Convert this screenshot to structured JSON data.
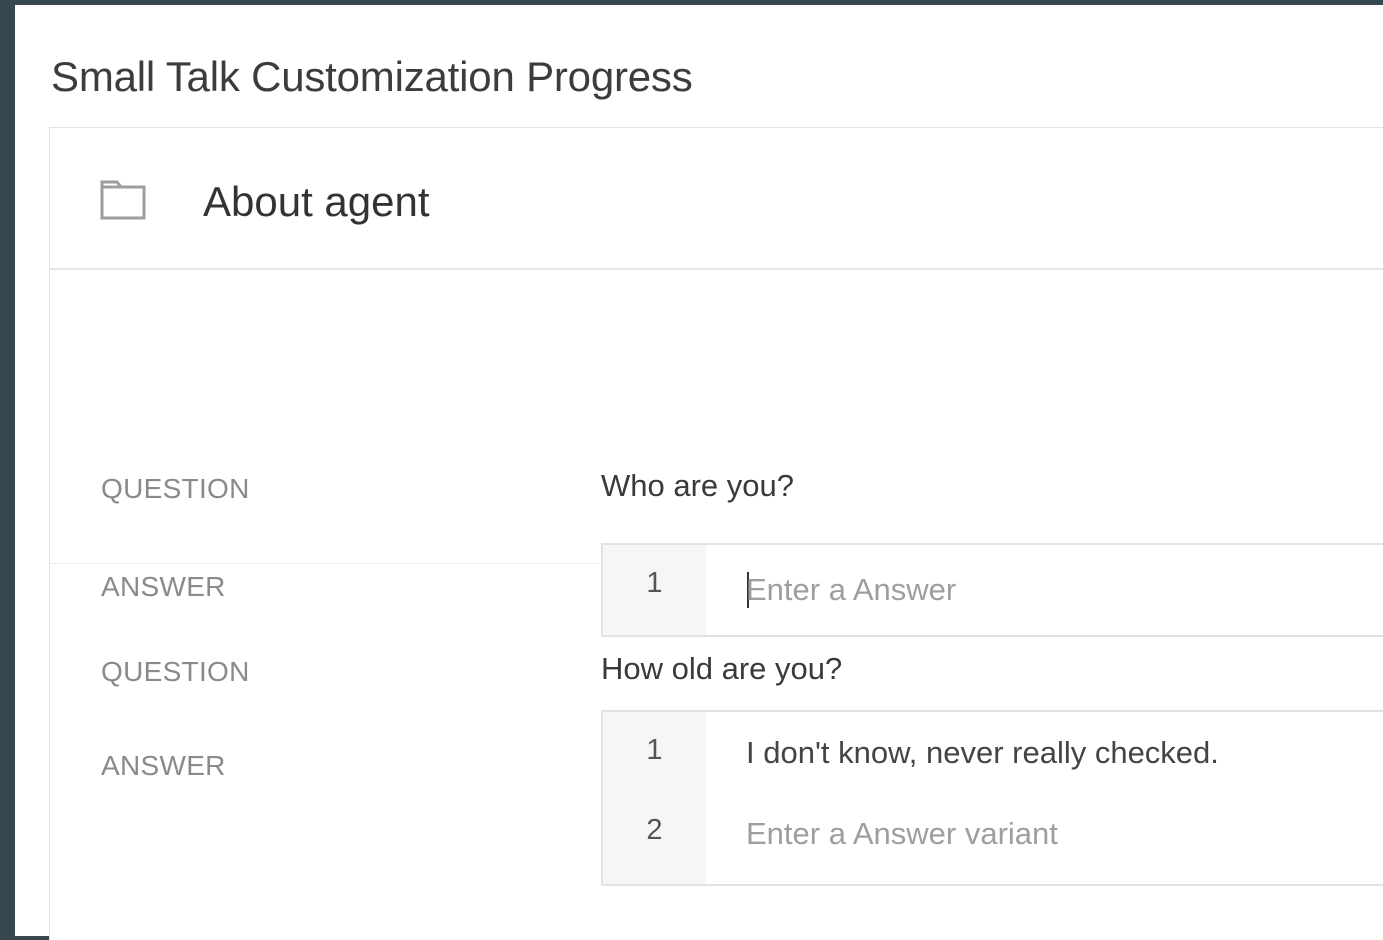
{
  "page": {
    "title": "Small Talk Customization Progress"
  },
  "section": {
    "title": "About agent",
    "icon": "folder-icon"
  },
  "labels": {
    "question": "QUESTION",
    "answer": "ANSWER"
  },
  "qa_items": [
    {
      "question": "Who are you?",
      "answers": [
        {
          "number": "1",
          "value": "",
          "placeholder": "Enter a Answer"
        }
      ]
    },
    {
      "question": "How old are you?",
      "answers": [
        {
          "number": "1",
          "value": "I don't know, never really checked.",
          "placeholder": ""
        },
        {
          "number": "2",
          "value": "",
          "placeholder": "Enter a Answer variant"
        }
      ]
    }
  ],
  "colors": {
    "frame": "#37474f",
    "background": "#ffffff",
    "label": "#8a8a8a",
    "number_column": "#f6f6f6"
  }
}
